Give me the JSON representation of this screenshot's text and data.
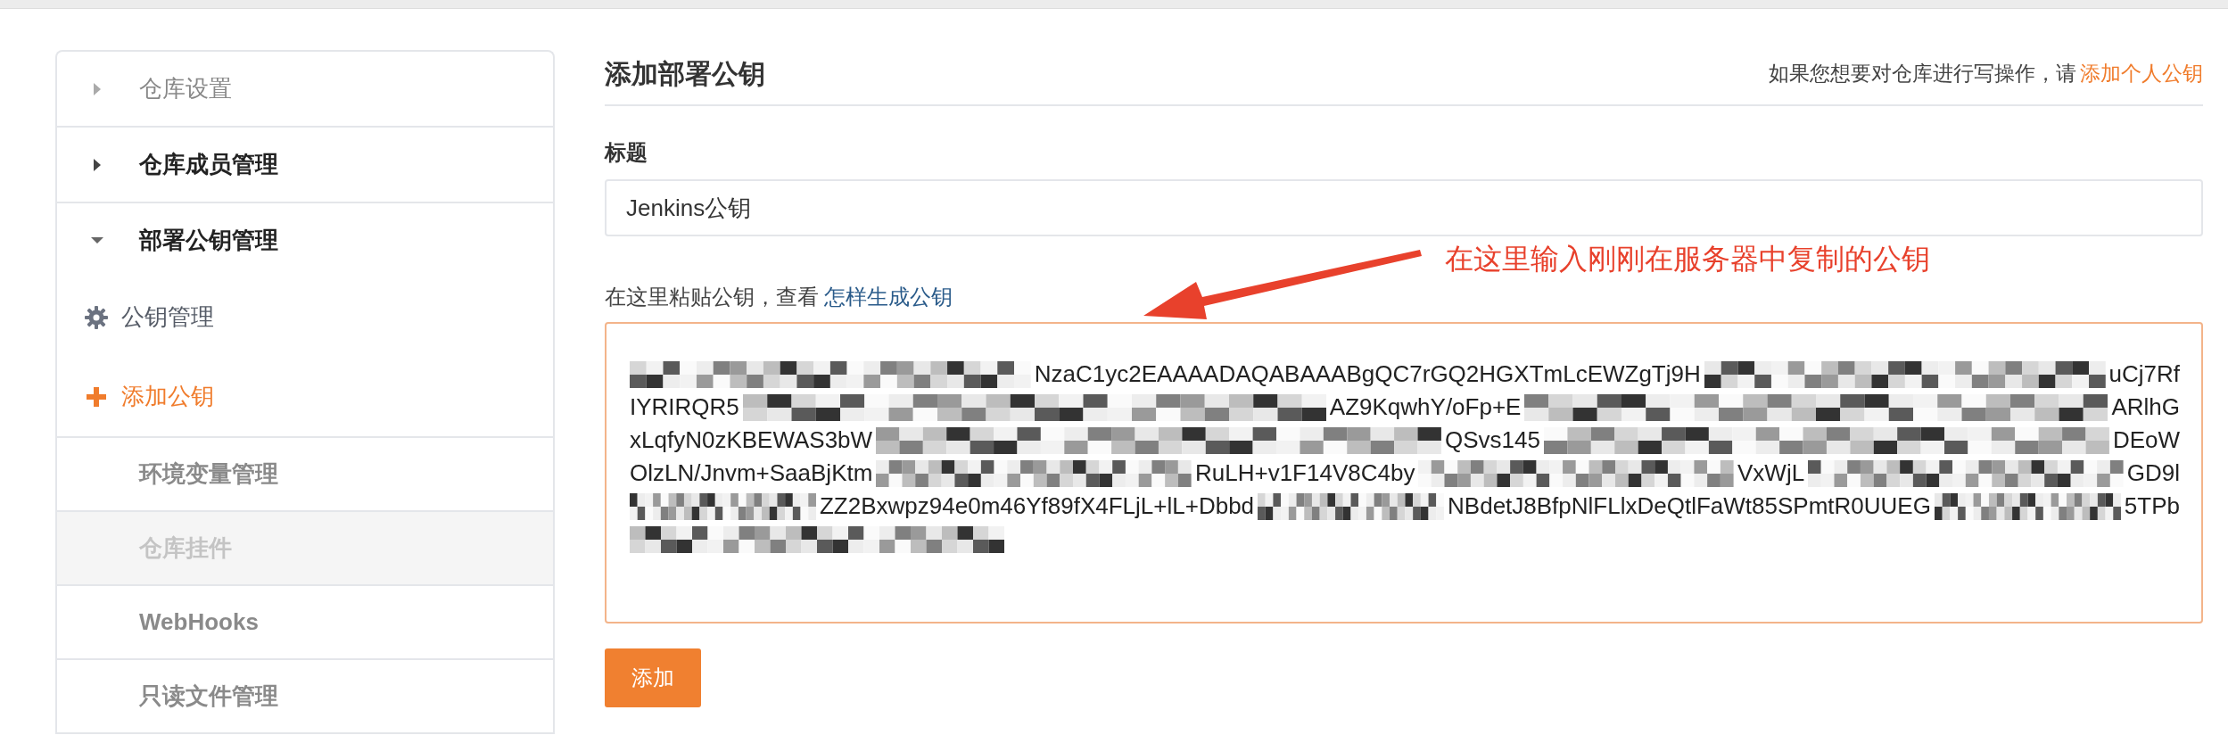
{
  "sidebar": {
    "items": [
      {
        "label": "仓库设置",
        "kind": "group",
        "expanded": false,
        "emphasis": false
      },
      {
        "label": "仓库成员管理",
        "kind": "group",
        "expanded": false,
        "emphasis": true
      },
      {
        "label": "部署公钥管理",
        "kind": "group",
        "expanded": true,
        "emphasis": true,
        "children": [
          {
            "label": "公钥管理",
            "kind": "manage",
            "selected": false
          },
          {
            "label": "添加公钥",
            "kind": "add",
            "selected": true
          }
        ]
      },
      {
        "label": "环境变量管理",
        "kind": "link",
        "disabled": false
      },
      {
        "label": "仓库挂件",
        "kind": "link",
        "disabled": true
      },
      {
        "label": "WebHooks",
        "kind": "link",
        "disabled": false
      },
      {
        "label": "只读文件管理",
        "kind": "link",
        "disabled": false
      }
    ]
  },
  "page": {
    "title": "添加部署公钥",
    "hint": "如果您想要对仓库进行写操作，请",
    "hint_link": "添加个人公钥"
  },
  "form": {
    "title_label": "标题",
    "title_value": "Jenkins公钥",
    "key_help": "在这里粘贴公钥，查看",
    "key_help_link": "怎样生成公钥",
    "key_lines": [
      {
        "segments": [
          {
            "kind": "mosaic"
          },
          {
            "kind": "text",
            "text": "NzaC1yc2EAAAADAQABAAABgQC7rGQ2HGXTmLcEWZgTj9H"
          },
          {
            "kind": "mosaic"
          },
          {
            "kind": "text",
            "text": "uCj7Rf"
          }
        ]
      },
      {
        "segments": [
          {
            "kind": "text",
            "text": "IYRIRQR5"
          },
          {
            "kind": "mosaic"
          },
          {
            "kind": "text",
            "text": "AZ9KqwhY/oFp+E"
          },
          {
            "kind": "mosaic"
          },
          {
            "kind": "text",
            "text": "ARlhG"
          }
        ]
      },
      {
        "segments": [
          {
            "kind": "text",
            "text": "xLqfyN0zKBEWAS3bW"
          },
          {
            "kind": "mosaic"
          },
          {
            "kind": "text",
            "text": "QSvs145"
          },
          {
            "kind": "mosaic"
          },
          {
            "kind": "text",
            "text": "DEoW"
          }
        ]
      },
      {
        "segments": [
          {
            "kind": "text",
            "text": "OlzLN/Jnvm+SaaBjKtm"
          },
          {
            "kind": "mosaic"
          },
          {
            "kind": "text",
            "text": "RuLH+v1F14V8C4by"
          },
          {
            "kind": "mosaic"
          },
          {
            "kind": "text",
            "text": "VxWjL"
          },
          {
            "kind": "mosaic"
          },
          {
            "kind": "text",
            "text": "GD9l"
          }
        ]
      },
      {
        "segments": [
          {
            "kind": "mosaic"
          },
          {
            "kind": "text",
            "text": "ZZ2Bxwpz94e0m46Yf89fX4FLjL+lL+Dbbd"
          },
          {
            "kind": "mosaic"
          },
          {
            "kind": "text",
            "text": "NBdetJ8BfpNlFLlxDeQtlFaWt85SPmtR0UUEG"
          },
          {
            "kind": "mosaic"
          },
          {
            "kind": "text",
            "text": "5TPb"
          }
        ]
      },
      {
        "segments": [
          {
            "kind": "mosaic"
          }
        ]
      }
    ],
    "submit": "添加"
  },
  "annotation": {
    "text": "在这里输入刚刚在服务器中复制的公钥"
  }
}
